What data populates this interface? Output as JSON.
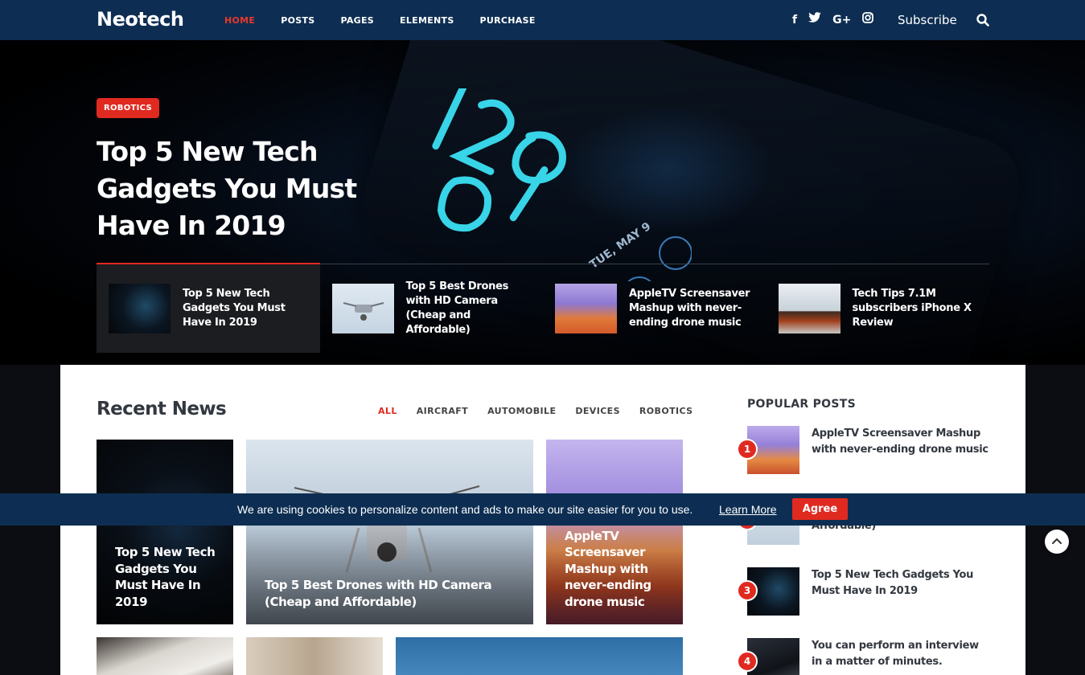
{
  "nav": {
    "logo": "Neotech",
    "items": [
      {
        "label": "HOME",
        "active": true
      },
      {
        "label": "POSTS",
        "active": false
      },
      {
        "label": "PAGES",
        "active": false
      },
      {
        "label": "ELEMENTS",
        "active": false
      },
      {
        "label": "PURCHASE",
        "active": false
      }
    ],
    "social": [
      "facebook-icon",
      "twitter-icon",
      "google-plus-icon",
      "instagram-icon"
    ],
    "subscribe": "Subscribe"
  },
  "hero": {
    "badge": "ROBOTICS",
    "title": "Top 5 New Tech Gadgets You Must Have In 2019",
    "strip": [
      {
        "title": "Top 5 New Tech Gadgets You Must Have In 2019",
        "active": true
      },
      {
        "title": "Top 5 Best Drones with HD Camera (Cheap and Affordable)",
        "active": false
      },
      {
        "title": "AppleTV Screensaver Mashup with never-ending drone music",
        "active": false
      },
      {
        "title": "Tech Tips 7.1M subscribers iPhone X Review",
        "active": false
      }
    ]
  },
  "recent": {
    "title": "Recent News",
    "filters": [
      "ALL",
      "AIRCRAFT",
      "AUTOMOBILE",
      "DEVICES",
      "ROBOTICS"
    ],
    "active_filter": "ALL",
    "cards": [
      {
        "title": "Top 5 New Tech Gadgets You Must Have In 2019"
      },
      {
        "title": "Top 5 Best Drones with HD Camera (Cheap and Affordable)"
      },
      {
        "title": "AppleTV Screensaver Mashup with never-ending drone music"
      }
    ]
  },
  "popular": {
    "title": "POPULAR POSTS",
    "items": [
      {
        "num": "1",
        "title": "AppleTV Screensaver Mashup with never-ending drone music"
      },
      {
        "num": "2",
        "title": "Affordable)"
      },
      {
        "num": "3",
        "title": "Top 5 New Tech Gadgets You Must Have In 2019"
      },
      {
        "num": "4",
        "title": "You can perform an interview in a matter of minutes."
      }
    ]
  },
  "cookie": {
    "text": "We are using cookies to personalize content and ads to make our site easier for you to use.",
    "link": "Learn More",
    "button": "Agree"
  },
  "colors": {
    "nav_bg": "#0d2e52",
    "accent": "#e02a20",
    "heading": "#333840"
  }
}
